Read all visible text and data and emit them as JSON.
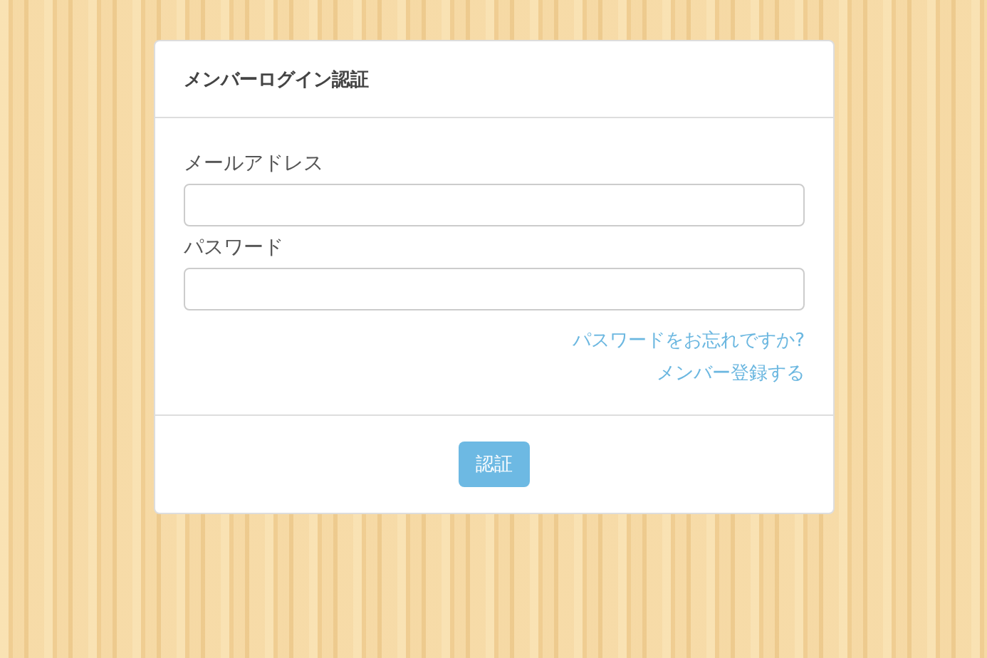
{
  "panel": {
    "title": "メンバーログイン認証"
  },
  "fields": [
    {
      "label": "メールアドレス"
    },
    {
      "label": "パスワード"
    }
  ],
  "links": [
    "パスワードをお忘れですか?",
    "メンバー登録する"
  ],
  "submit_button": "認証"
}
